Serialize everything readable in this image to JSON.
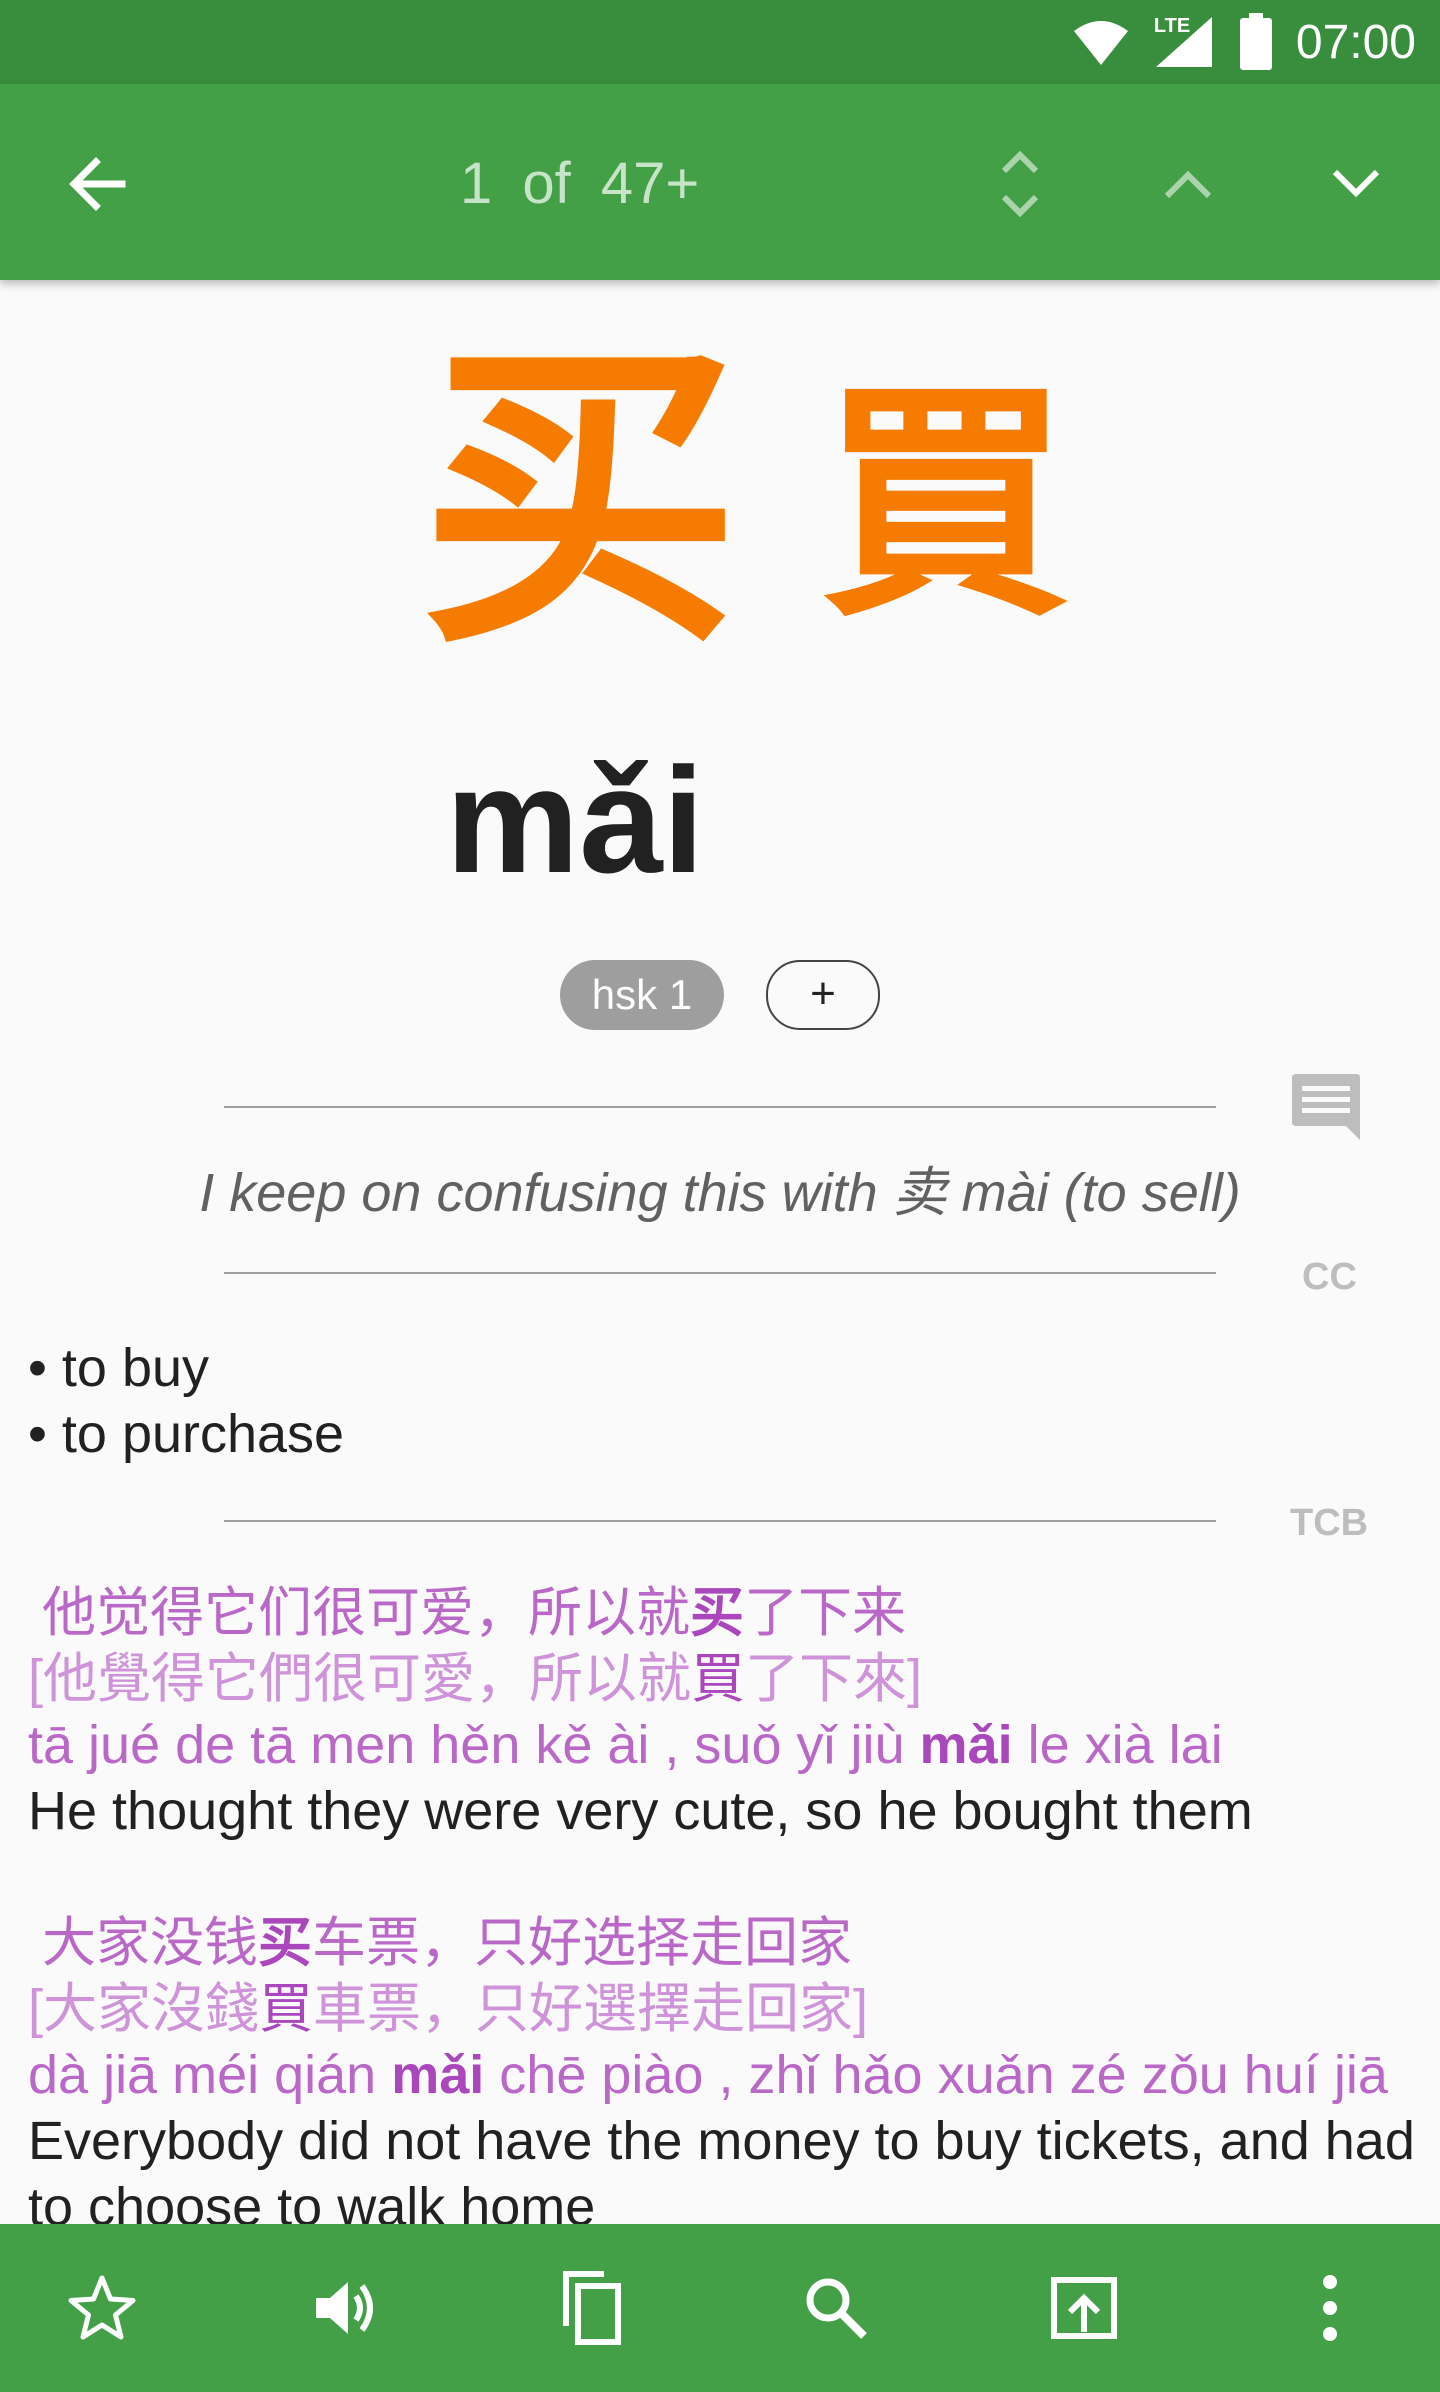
{
  "status_bar": {
    "time": "07:00",
    "network": "LTE"
  },
  "app_bar": {
    "counter": "1 of 47+"
  },
  "entry": {
    "simplified": "买",
    "traditional": "買",
    "pinyin": "mǎi",
    "hsk_badge": "hsk 1",
    "add_tag": "+",
    "note": "I keep on confusing this with 卖 mài (to sell)",
    "note_source": "CC",
    "definitions": [
      "• to buy",
      "• to purchase"
    ],
    "definitions_source": "TCB"
  },
  "examples": [
    {
      "simp_pre": "他觉得它们很可爱，所以就",
      "simp_hl": "买",
      "simp_post": "了下来",
      "trad_open": "[",
      "trad_pre": "他覺得它們很可愛，所以就",
      "trad_hl": "買",
      "trad_post": "了下來",
      "trad_close": "]",
      "py_pre": "tā jué de tā men hěn kě ài , suǒ yǐ jiù ",
      "py_hl": "mǎi",
      "py_post": " le xià lai",
      "english": "He thought they were very cute, so he bought them"
    },
    {
      "simp_pre": "大家没钱",
      "simp_hl": "买",
      "simp_post": "车票，只好选择走回家",
      "trad_open": "[",
      "trad_pre": "大家沒錢",
      "trad_hl": "買",
      "trad_post": "車票，只好選擇走回家",
      "trad_close": "]",
      "py_pre": "dà jiā méi qián ",
      "py_hl": "mǎi",
      "py_post": " chē piào , zhǐ hǎo xuǎn zé zǒu huí jiā",
      "english": "Everybody did not have the money to buy tickets, and had to choose to walk home"
    }
  ],
  "icons": {
    "back": "arrow-left-icon",
    "expand": "unfold-icon",
    "prev": "chevron-up-icon",
    "next": "chevron-down-icon",
    "note": "comment-icon",
    "star": "star-outline-icon",
    "speaker": "volume-icon",
    "copy": "copy-icon",
    "search": "search-icon",
    "share": "share-icon",
    "more": "more-vert-icon"
  },
  "colors": {
    "primary": "#43a047",
    "status": "#388e3c",
    "hanzi": "#f57c00",
    "example": "#ba68c8"
  }
}
